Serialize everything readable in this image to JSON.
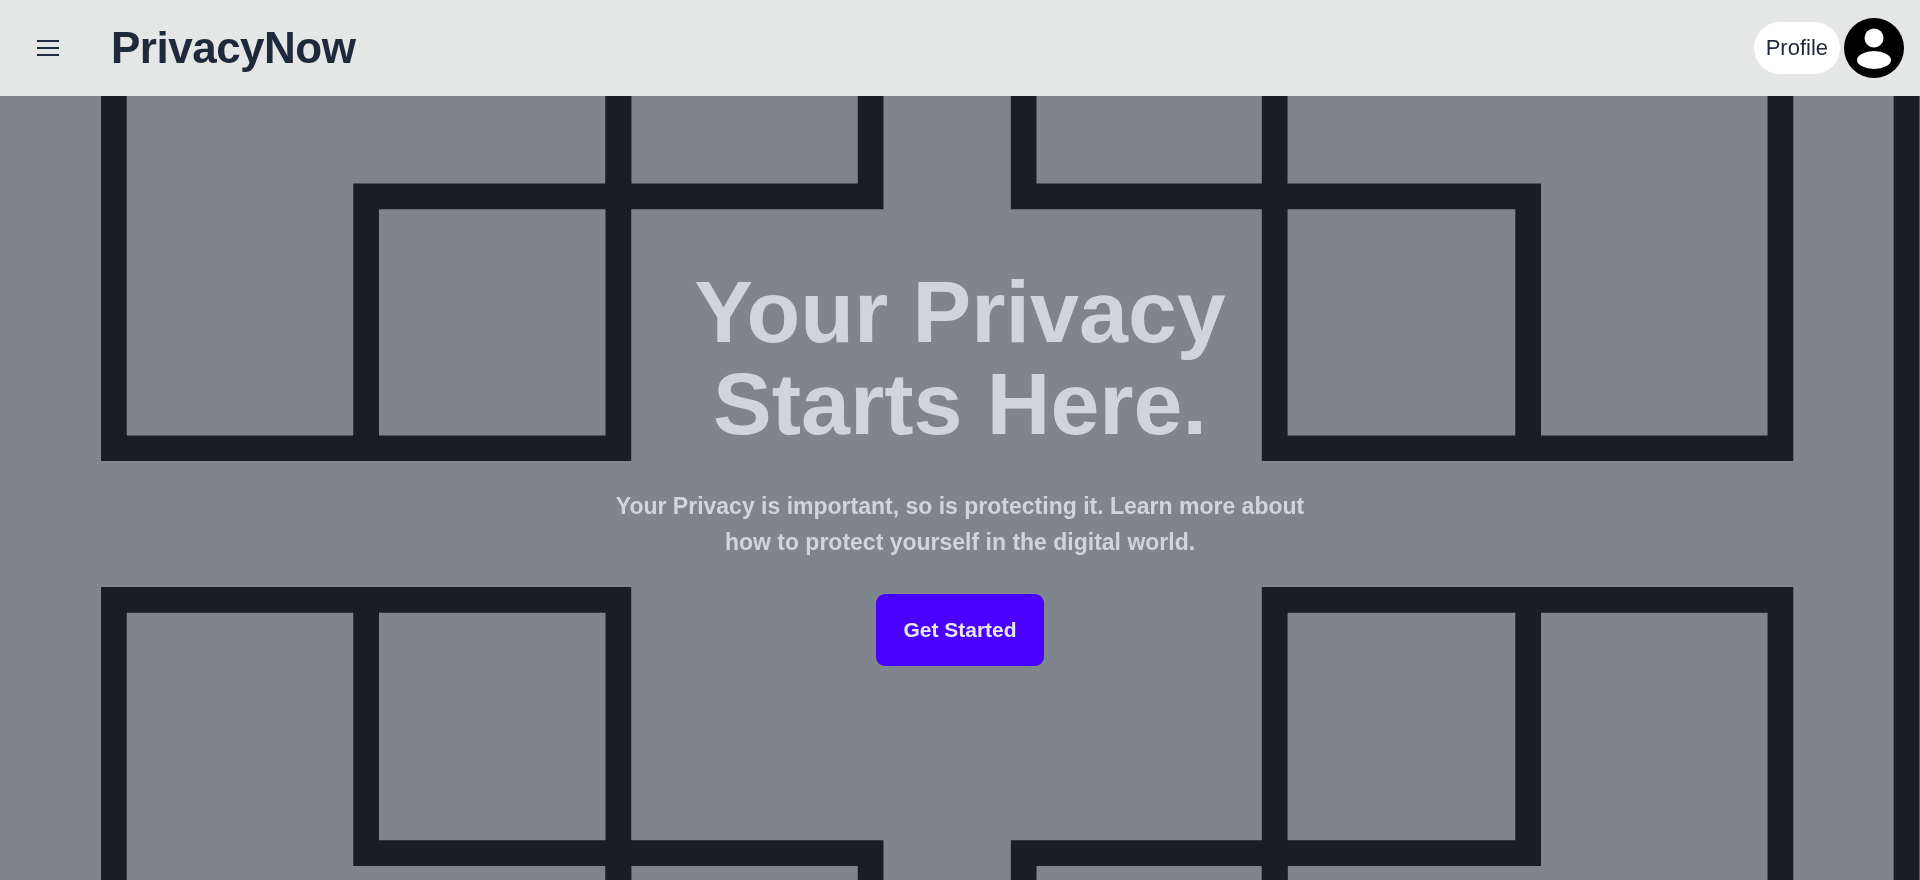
{
  "header": {
    "logo": "PrivacyNow",
    "profile_button": "Profile"
  },
  "hero": {
    "title": "Your Privacy Starts Here.",
    "subtitle": "Your Privacy is important, so is protecting it. Learn more about how to protect yourself in the digital world.",
    "button": "Get Started"
  }
}
